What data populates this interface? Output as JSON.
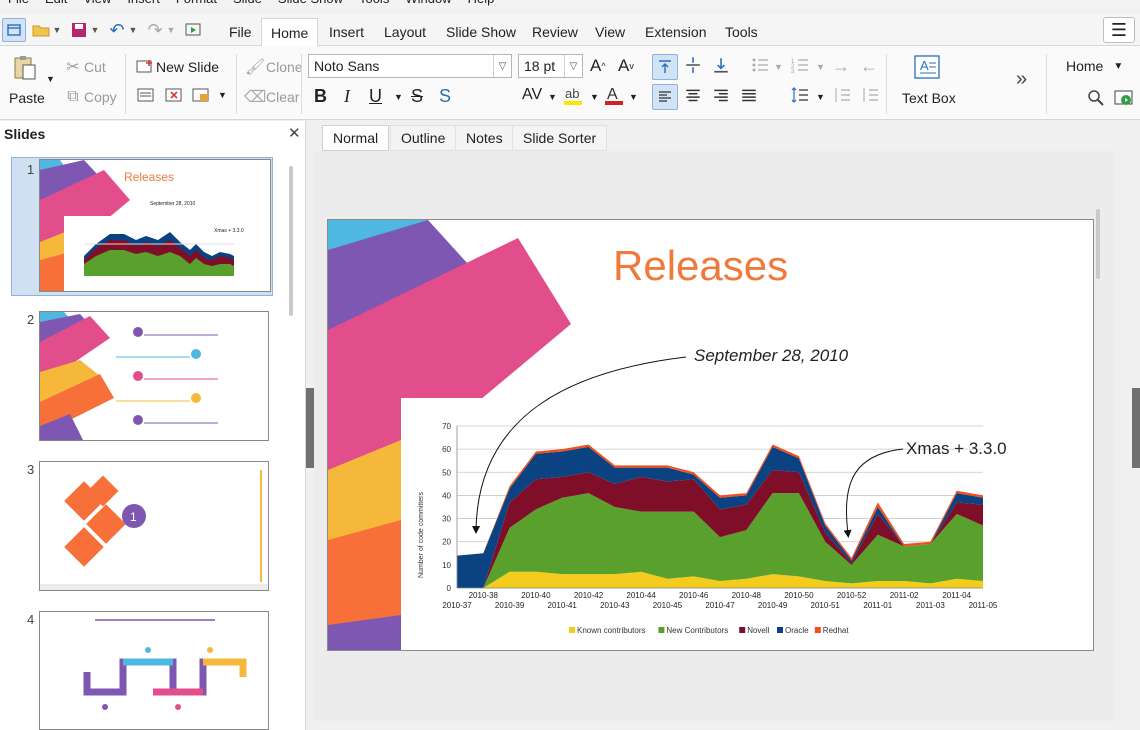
{
  "menu": [
    "File",
    "Edit",
    "View",
    "Insert",
    "Format",
    "Slide",
    "Slide Show",
    "Tools",
    "Window",
    "Help"
  ],
  "tabs": [
    "File",
    "Home",
    "Insert",
    "Layout",
    "Slide Show",
    "Review",
    "View",
    "Extension",
    "Tools"
  ],
  "active_tab": "Home",
  "ribbon": {
    "paste": "Paste",
    "cut": "Cut",
    "copy": "Copy",
    "new_slide": "New Slide",
    "clone": "Clone",
    "clear": "Clear",
    "font_name": "Noto Sans",
    "font_size": "18 pt",
    "text_box": "Text Box",
    "more": "»",
    "home_menu": "Home"
  },
  "slides_panel": {
    "title": "Slides",
    "numbers": [
      "1",
      "2",
      "3",
      "4"
    ]
  },
  "view_tabs": [
    "Normal",
    "Outline",
    "Notes",
    "Slide Sorter"
  ],
  "active_view": "Normal",
  "slide": {
    "title": "Releases",
    "annotation_1": "September 28, 2010",
    "annotation_2": "Xmas + 3.3.0"
  },
  "colors": {
    "accent_orange": "#f07a3c",
    "stripe_blue": "#4fb8e0",
    "stripe_purple": "#7e57b3",
    "stripe_pink": "#e24d8b",
    "stripe_yellow": "#f6b83a",
    "stripe_orange": "#f7703a"
  },
  "chart_data": {
    "type": "area",
    "ylabel": "Number of code committers",
    "ylim": [
      0,
      70
    ],
    "yticks": [
      0,
      10,
      20,
      30,
      40,
      50,
      60,
      70
    ],
    "x": [
      "2010-37",
      "2010-38",
      "2010-39",
      "2010-40",
      "2010-41",
      "2010-42",
      "2010-43",
      "2010-44",
      "2010-45",
      "2010-46",
      "2010-47",
      "2010-48",
      "2010-49",
      "2010-50",
      "2010-51",
      "2010-52",
      "2011-01",
      "2011-02",
      "2011-03",
      "2011-04",
      "2011-05"
    ],
    "series": [
      {
        "name": "Known contributors",
        "color": "#f4cc1c",
        "values": [
          0,
          0,
          7,
          7,
          6,
          6,
          6,
          7,
          4,
          5,
          3,
          4,
          6,
          5,
          3,
          2,
          3,
          3,
          2,
          4,
          3
        ]
      },
      {
        "name": "New Contributors",
        "color": "#5aa02c",
        "values": [
          0,
          0,
          19,
          27,
          33,
          35,
          29,
          26,
          29,
          28,
          19,
          21,
          35,
          36,
          17,
          8,
          20,
          15,
          17,
          28,
          24
        ]
      },
      {
        "name": "Novell",
        "color": "#7f0f29",
        "values": [
          0,
          0,
          11,
          13,
          9,
          9,
          10,
          15,
          13,
          14,
          12,
          11,
          10,
          9,
          4,
          1,
          9,
          0,
          0,
          5,
          9
        ]
      },
      {
        "name": "Oracle",
        "color": "#0b4382",
        "values": [
          14,
          15,
          6,
          11,
          11,
          11,
          7,
          4,
          6,
          2,
          5,
          4,
          10,
          6,
          3,
          1,
          3,
          0,
          0,
          4,
          3
        ]
      },
      {
        "name": "Redhat",
        "color": "#f24f1c",
        "values": [
          0,
          0,
          1,
          1,
          1,
          1,
          1,
          1,
          1,
          1,
          1,
          1,
          1,
          1,
          1,
          1,
          2,
          1,
          1,
          1,
          1
        ]
      }
    ]
  }
}
